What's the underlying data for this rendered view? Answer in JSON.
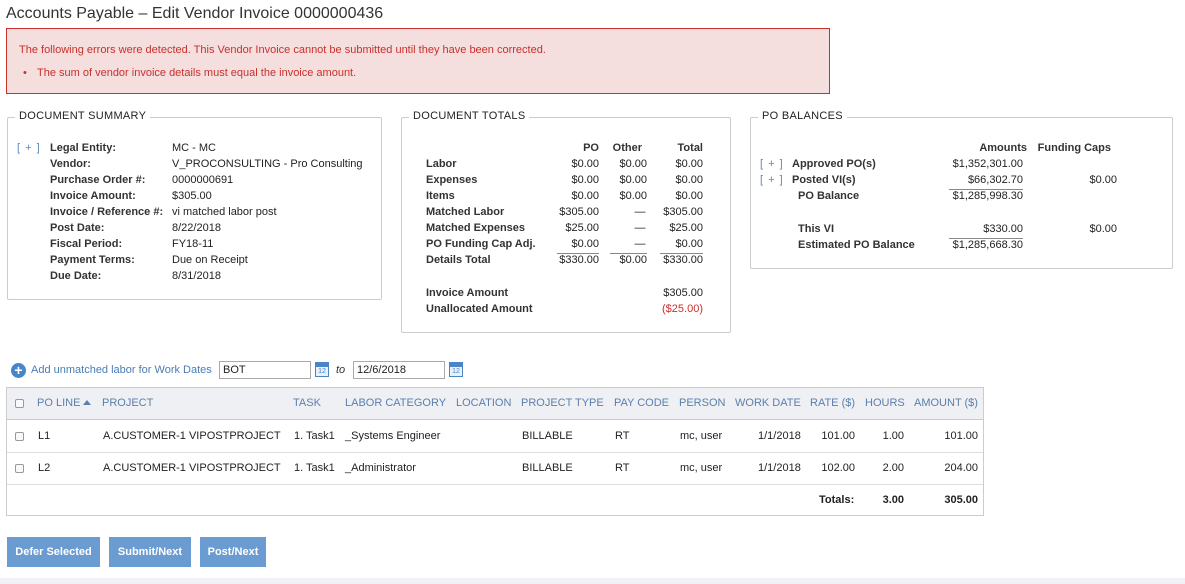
{
  "page_title": "Accounts Payable – Edit Vendor Invoice 0000000436",
  "errors": {
    "message": "The following errors were detected. This Vendor Invoice cannot be submitted until they have been corrected.",
    "items": [
      "The sum of vendor invoice details must equal the invoice amount."
    ]
  },
  "document_summary": {
    "title": "DOCUMENT SUMMARY",
    "expand": "[ + ]",
    "fields": [
      {
        "label": "Legal Entity:",
        "value": "MC - MC"
      },
      {
        "label": "Vendor:",
        "value": "V_PROCONSULTING - Pro Consulting"
      },
      {
        "label": "Purchase Order #:",
        "value": "0000000691"
      },
      {
        "label": "Invoice Amount:",
        "value": "$305.00"
      },
      {
        "label": "Invoice / Reference #:",
        "value": "vi matched labor post"
      },
      {
        "label": "Post Date:",
        "value": "8/22/2018"
      },
      {
        "label": "Fiscal Period:",
        "value": "FY18-11"
      },
      {
        "label": "Payment Terms:",
        "value": "Due on Receipt"
      },
      {
        "label": "Due Date:",
        "value": "8/31/2018"
      }
    ]
  },
  "document_totals": {
    "title": "DOCUMENT TOTALS",
    "columns": [
      "PO",
      "Other",
      "Total"
    ],
    "rows": [
      {
        "label": "Labor",
        "po": "$0.00",
        "other": "$0.00",
        "total": "$0.00"
      },
      {
        "label": "Expenses",
        "po": "$0.00",
        "other": "$0.00",
        "total": "$0.00"
      },
      {
        "label": "Items",
        "po": "$0.00",
        "other": "$0.00",
        "total": "$0.00"
      },
      {
        "label": "Matched Labor",
        "po": "$305.00",
        "other": "—",
        "total": "$305.00"
      },
      {
        "label": "Matched Expenses",
        "po": "$25.00",
        "other": "—",
        "total": "$25.00"
      },
      {
        "label": "PO Funding Cap Adj.",
        "po": "$0.00",
        "other": "—",
        "total": "$0.00"
      },
      {
        "label": "Details Total",
        "po": "$330.00",
        "other": "$0.00",
        "total": "$330.00"
      }
    ],
    "invoice_amount_label": "Invoice Amount",
    "invoice_amount": "$305.00",
    "unallocated_label": "Unallocated Amount",
    "unallocated": "($25.00)"
  },
  "po_balances": {
    "title": "PO BALANCES",
    "col_amounts": "Amounts",
    "col_funding": "Funding Caps",
    "expand": "[ + ]",
    "approved_label": "Approved PO(s)",
    "approved_amount": "$1,352,301.00",
    "posted_label": "Posted VI(s)",
    "posted_amount": "$66,302.70",
    "posted_cap": "$0.00",
    "balance_label": "PO Balance",
    "balance_amount": "$1,285,998.30",
    "this_vi_label": "This VI",
    "this_vi_amount": "$330.00",
    "this_vi_cap": "$0.00",
    "estimated_label": "Estimated PO Balance",
    "estimated_amount": "$1,285,668.30"
  },
  "unmatched": {
    "link": "Add unmatched labor for Work Dates",
    "from_value": "BOT",
    "to_label": "to",
    "to_value": "12/6/2018",
    "calendar_day": "12"
  },
  "grid": {
    "headers": [
      "PO LINE",
      "PROJECT",
      "TASK",
      "LABOR CATEGORY",
      "LOCATION",
      "PROJECT TYPE",
      "PAY CODE",
      "PERSON",
      "WORK DATE",
      "RATE ($)",
      "HOURS",
      "AMOUNT ($)"
    ],
    "rows": [
      {
        "po_line": "L1",
        "project": "A.CUSTOMER-1 VIPOSTPROJECT",
        "task": "1. Task1",
        "labor_category": "_Systems Engineer",
        "location": "",
        "project_type": "BILLABLE",
        "pay_code": "RT",
        "person": "mc, user",
        "work_date": "1/1/2018",
        "rate": "101.00",
        "hours": "1.00",
        "amount": "101.00"
      },
      {
        "po_line": "L2",
        "project": "A.CUSTOMER-1 VIPOSTPROJECT",
        "task": "1. Task1",
        "labor_category": "_Administrator",
        "location": "",
        "project_type": "BILLABLE",
        "pay_code": "RT",
        "person": "mc, user",
        "work_date": "1/1/2018",
        "rate": "102.00",
        "hours": "2.00",
        "amount": "204.00"
      }
    ],
    "totals_label": "Totals:",
    "totals_hours": "3.00",
    "totals_amount": "305.00"
  },
  "buttons": {
    "defer": "Defer Selected",
    "submit_next": "Submit/Next",
    "post_next": "Post/Next"
  }
}
